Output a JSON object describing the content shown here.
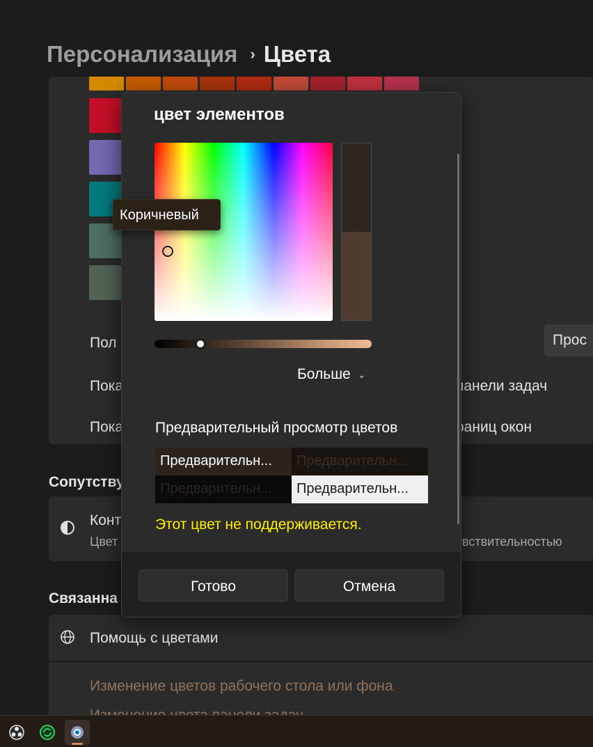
{
  "header": {
    "parent": "Персонализация",
    "separator": "›",
    "current": "Цвета"
  },
  "background": {
    "swatch_colors_top": [
      "#d38a00",
      "#c75b00",
      "#c24a0e",
      "#a8340f",
      "#b12a12",
      "#c34b38",
      "#a8222d",
      "#c2303d",
      "#b5324c"
    ],
    "swatch_colors_left": [
      "#c30f27",
      "#7468b3",
      "#047a7f",
      "#4d6e63",
      "#526356"
    ],
    "row_mode_label": "Пол",
    "row_mode_button": "Прос",
    "row_taskbar_left": "Пока",
    "row_taskbar_right": "панели задач",
    "row_borders_left": "Пока",
    "row_borders_right": "раниц окон",
    "section_related_left": "Сопутству",
    "contrast_title": "Конт",
    "contrast_sub": "Цвет",
    "contrast_right": "увствительностью",
    "section_links": "Связанна",
    "help_label": "Помощь с цветами",
    "link1": "Изменение цветов рабочего стола или фона",
    "link2": "Изменение цвета панели задач"
  },
  "dialog": {
    "title": "цвет элементов",
    "more_label": "Больше",
    "preview_title": "Предварительный просмотр цветов",
    "preview_cells": [
      "Предварительн...",
      "Предварительн...",
      "Предварительн...",
      "Предварительн..."
    ],
    "warning": "Этот цвет не поддерживается.",
    "done_button": "Готово",
    "cancel_button": "Отмена",
    "selected_preview_color": "#4f3c30",
    "value_level": 0.21
  },
  "tooltip": {
    "text": "Коричневый"
  },
  "taskbar": {
    "icons": [
      "obs-icon",
      "sync-icon",
      "settings-icon"
    ],
    "accent": "#0078d4"
  }
}
